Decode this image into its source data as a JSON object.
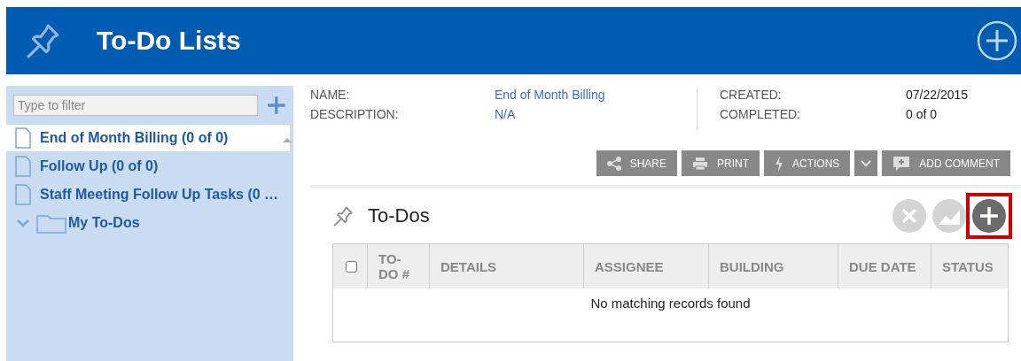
{
  "header": {
    "title": "To-Do Lists"
  },
  "sidebar": {
    "filter": {
      "placeholder": "Type to filter"
    },
    "items": [
      {
        "kind": "list",
        "label": "End of Month Billing (0 of 0)",
        "selected": true
      },
      {
        "kind": "list",
        "label": "Follow Up (0 of 0)",
        "selected": false
      },
      {
        "kind": "list",
        "label": "Staff Meeting Follow Up Tasks (0 …",
        "selected": false
      },
      {
        "kind": "folder",
        "label": "My To-Dos",
        "selected": false,
        "expanded": true
      }
    ]
  },
  "details": {
    "fields": [
      {
        "label": "NAME:",
        "value": "End of Month Billing",
        "kind": "link"
      },
      {
        "label": "DESCRIPTION:",
        "value": "N/A",
        "kind": "link"
      }
    ],
    "fields_right": [
      {
        "label": "CREATED:",
        "value": "07/22/2015"
      },
      {
        "label": "COMPLETED:",
        "value": "0 of 0"
      }
    ]
  },
  "actions": [
    {
      "kind": "share",
      "label": "SHARE"
    },
    {
      "kind": "print",
      "label": "PRINT"
    },
    {
      "kind": "actions",
      "label": "ACTIONS"
    },
    {
      "kind": "dropdown"
    },
    {
      "kind": "comment",
      "label": "ADD COMMENT"
    }
  ],
  "todos": {
    "title": "To-Dos",
    "tools": [
      {
        "kind": "remove",
        "disabled": true,
        "highlighted": false
      },
      {
        "kind": "chart",
        "disabled": true,
        "highlighted": false
      },
      {
        "kind": "add",
        "disabled": false,
        "highlighted": true
      }
    ],
    "table": {
      "select_all_checked": false,
      "columns": [
        "TO-DO #",
        "DETAILS",
        "ASSIGNEE",
        "BUILDING",
        "DUE DATE",
        "STATUS"
      ],
      "empty_message": "No matching records found"
    }
  }
}
